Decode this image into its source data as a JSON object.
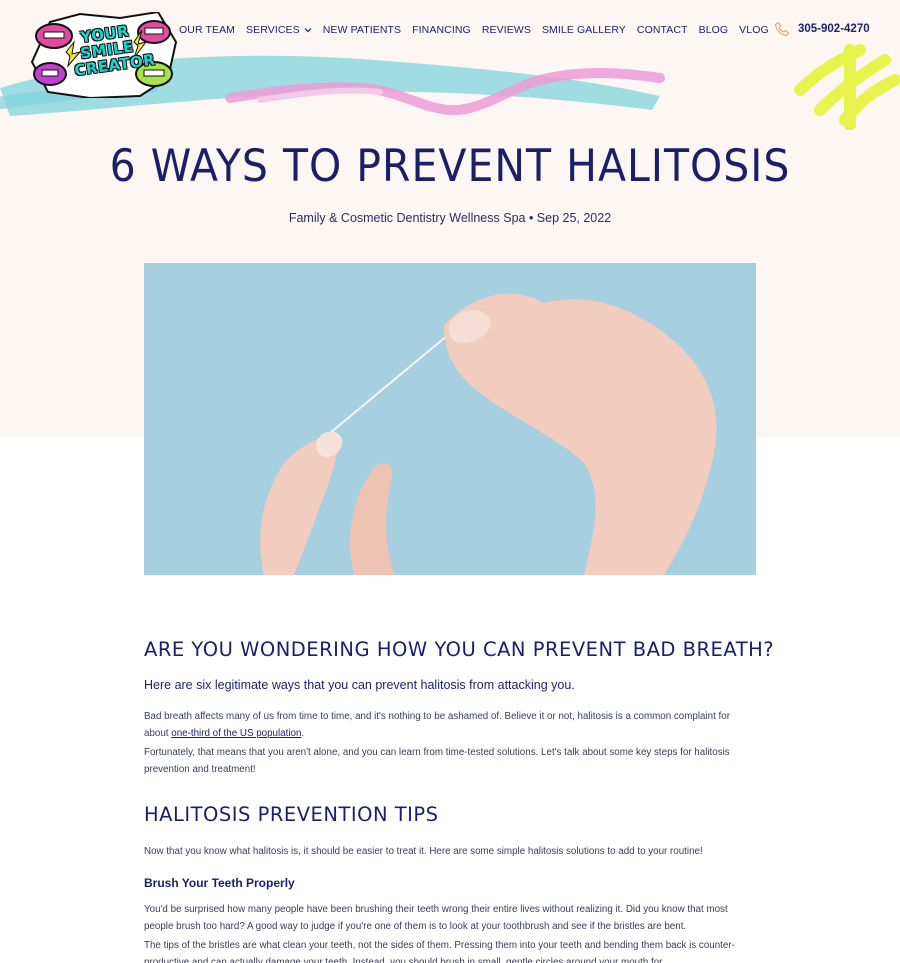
{
  "brand": {
    "logo_text": "YOUR SMILE CREATOR"
  },
  "nav": {
    "items": [
      {
        "label": "OUR TEAM"
      },
      {
        "label": "SERVICES"
      },
      {
        "label": "NEW PATIENTS"
      },
      {
        "label": "FINANCING"
      },
      {
        "label": "REVIEWS"
      },
      {
        "label": "SMILE GALLERY"
      },
      {
        "label": "CONTACT"
      },
      {
        "label": "BLOG"
      },
      {
        "label": "VLOG"
      }
    ],
    "phone": "305-902-4270"
  },
  "article": {
    "title": "6 WAYS TO PREVENT HALITOSIS",
    "meta": "Family & Cosmetic Dentistry Wellness Spa • Sep 25, 2022",
    "section1": {
      "heading": "ARE YOU WONDERING HOW YOU CAN PREVENT BAD BREATH?",
      "lead": "Here are six legitimate ways that you can prevent halitosis from attacking you.",
      "p1_before": "Bad breath affects many of us from time to time, and it's nothing to be ashamed of. Believe it or not, halitosis is a common complaint for about ",
      "p1_link": "one-third of the US population",
      "p1_after": ".",
      "p2": "Fortunately, that means that you aren't alone, and you can learn from time-tested solutions. Let's talk about some key steps for halitosis prevention and treatment!"
    },
    "section2": {
      "heading": "HALITOSIS PREVENTION TIPS",
      "intro": "Now that you know what halitosis is, it should be easier to treat it. Here are some simple halitosis solutions to add to your routine!",
      "sub_heading": "Brush Your Teeth Properly",
      "p1": "You'd be surprised how many people have been brushing their teeth wrong their entire lives without realizing it. Did you know that most people brush too hard? A good way to judge if you're one of them is to look at your toothbrush and see if the bristles are bent.",
      "p2": "The tips of the bristles are what clean your teeth, not the sides of them. Pressing them into your teeth and bending them back is counter-productive and can actually damage your teeth. Instead, you should brush in small, gentle circles around your mouth for"
    }
  },
  "colors": {
    "navy": "#1b1f6b",
    "hero_bg": "#fcf7f2",
    "sky": "#a6cfe0",
    "brush_blue": "#8fd8e0",
    "brush_pink": "#ec9bd6",
    "brush_yellow": "#e6f23c",
    "phone_icon": "#e8a865"
  }
}
